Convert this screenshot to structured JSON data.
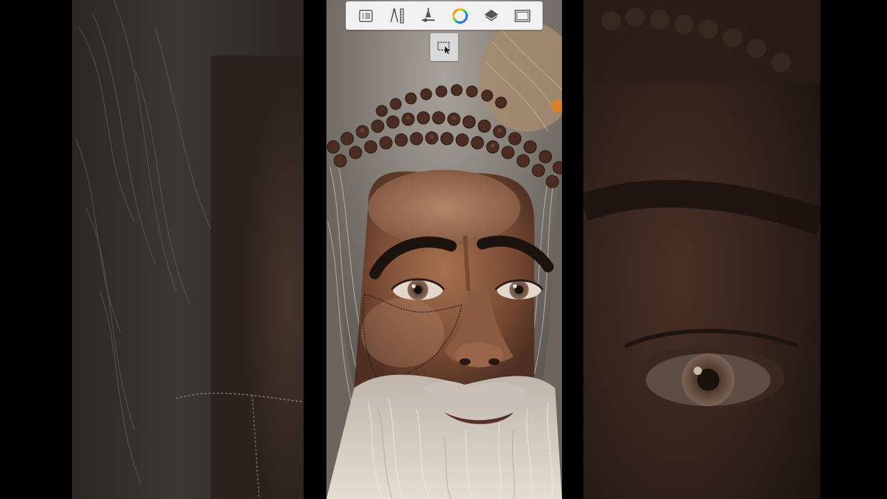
{
  "app": {
    "toolbar": {
      "tools": [
        {
          "icon": "list-icon"
        },
        {
          "icon": "ruler-guides-icon"
        },
        {
          "icon": "brush-stack-icon"
        },
        {
          "icon": "color-wheel-icon"
        },
        {
          "icon": "layers-icon"
        },
        {
          "icon": "canvas-frame-icon"
        }
      ]
    },
    "floating_tool": {
      "icon": "selection-marquee-icon"
    },
    "colors": {
      "toolbar_bg": "#f1f1f1",
      "icon": "#555555",
      "backdrop": "#000000"
    }
  }
}
